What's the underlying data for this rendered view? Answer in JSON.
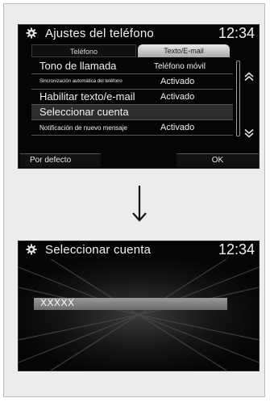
{
  "screen1": {
    "title": "Ajustes del teléfono",
    "clock": "12:34",
    "tabs": [
      "Teléfono",
      "Texto/E-mail"
    ],
    "items": [
      {
        "label": "Tono de llamada",
        "value": "Teléfono móvil"
      },
      {
        "label": "Sincronización automática del teléfono",
        "value": "Activado"
      },
      {
        "label": "Habilitar texto/e-mail",
        "value": "Activado"
      },
      {
        "label": "Seleccionar cuenta",
        "value": ""
      },
      {
        "label": "Notificación de nuevo mensaje",
        "value": "Activado"
      }
    ],
    "default_button": "Por defecto",
    "ok_button": "OK"
  },
  "screen2": {
    "title": "Seleccionar cuenta",
    "clock": "12:34",
    "account": "XXXXX"
  },
  "icons": {
    "settings": "gear-icon",
    "scroll_up": "double-chevron-up-icon",
    "scroll_down": "double-chevron-down-icon",
    "transition": "down-arrow-icon"
  }
}
